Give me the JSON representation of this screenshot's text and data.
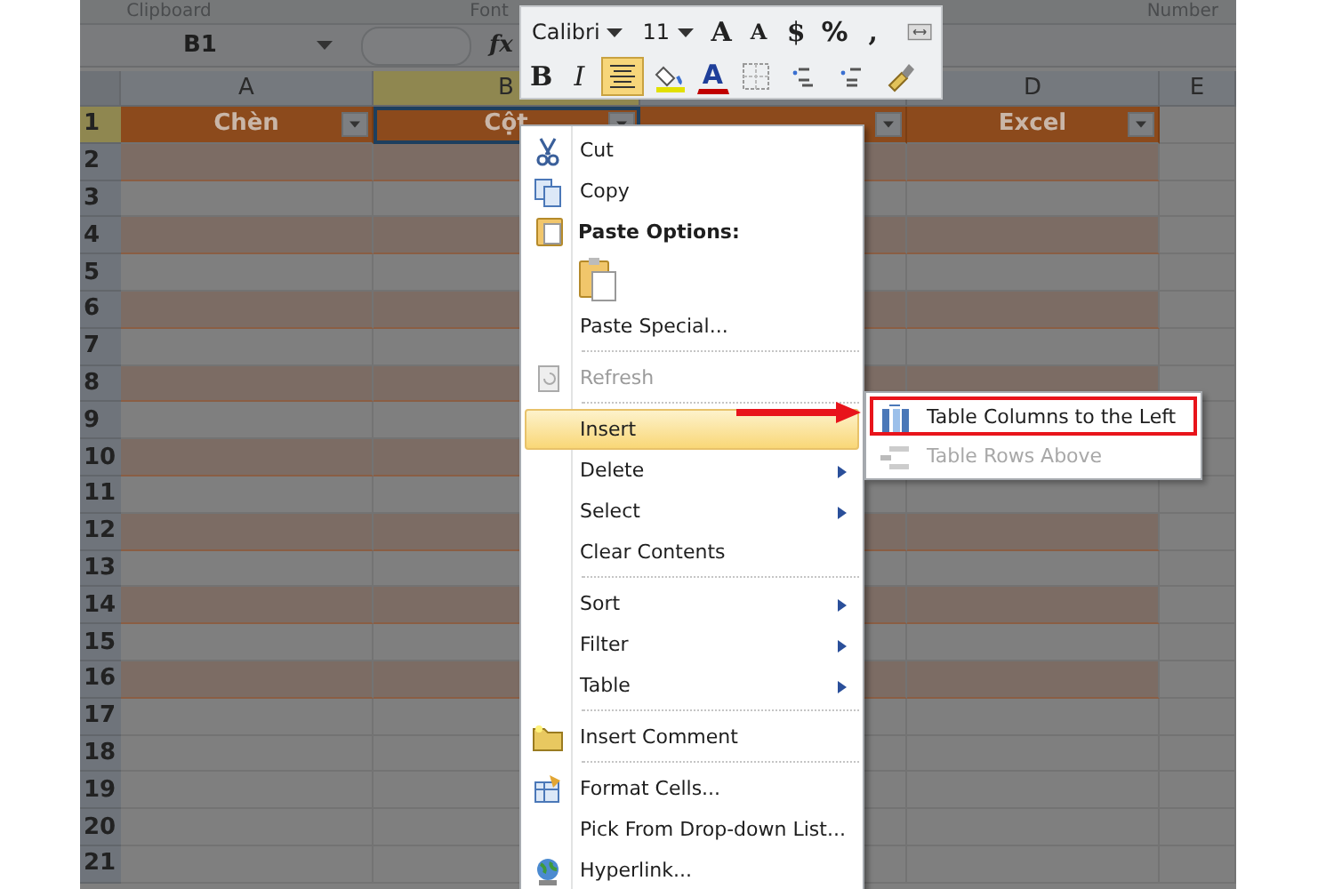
{
  "ribbon_groups": [
    "Clipboard",
    "Font",
    "Number"
  ],
  "name_box": {
    "value": "B1"
  },
  "formula_button": "fx",
  "mini_toolbar": {
    "font": "Calibri",
    "size": "11",
    "top_buttons": [
      {
        "kind": "grow",
        "label": "A"
      },
      {
        "kind": "shrink",
        "label": "A"
      },
      {
        "kind": "currency",
        "label": "$"
      },
      {
        "kind": "percent",
        "label": "%"
      },
      {
        "kind": "comma",
        "label": ","
      },
      {
        "kind": "merge"
      }
    ],
    "bottom_buttons": [
      {
        "kind": "bold",
        "label": "B",
        "selected": false
      },
      {
        "kind": "italic",
        "label": "I",
        "selected": false
      },
      {
        "kind": "center",
        "selected": true
      },
      {
        "kind": "fill",
        "selected": false
      },
      {
        "kind": "fontcolor",
        "label": "A",
        "selected": false
      },
      {
        "kind": "border",
        "selected": false
      },
      {
        "kind": "incdec",
        "selected": false
      },
      {
        "kind": "decdec",
        "selected": false
      },
      {
        "kind": "painter",
        "selected": false
      }
    ]
  },
  "columns": [
    {
      "label": "A",
      "selected": false
    },
    {
      "label": "B",
      "selected": true
    },
    {
      "selected": false
    },
    {
      "label": "D",
      "selected": false
    },
    {
      "label": "E",
      "selected": false
    }
  ],
  "header_cells": [
    {
      "text": "Chèn",
      "selected": false
    },
    {
      "text": "Cột",
      "selected": true
    },
    {
      "selected": false
    },
    {
      "text": "Excel",
      "selected": false
    }
  ],
  "rows": [
    {
      "number": "1",
      "kind": "header"
    },
    {
      "number": "2",
      "kind": "band"
    },
    {
      "number": "3",
      "kind": "plain"
    },
    {
      "number": "4",
      "kind": "band"
    },
    {
      "number": "5",
      "kind": "plain"
    },
    {
      "number": "6",
      "kind": "band"
    },
    {
      "number": "7",
      "kind": "plain"
    },
    {
      "number": "8",
      "kind": "band"
    },
    {
      "number": "9",
      "kind": "plain"
    },
    {
      "number": "10",
      "kind": "band"
    },
    {
      "number": "11",
      "kind": "plain"
    },
    {
      "number": "12",
      "kind": "band"
    },
    {
      "number": "13",
      "kind": "plain"
    },
    {
      "number": "14",
      "kind": "band"
    },
    {
      "number": "15",
      "kind": "plain"
    },
    {
      "number": "16",
      "kind": "band"
    },
    {
      "number": "17",
      "kind": "empty"
    },
    {
      "number": "18",
      "kind": "empty"
    },
    {
      "number": "19",
      "kind": "empty"
    },
    {
      "number": "20",
      "kind": "empty"
    },
    {
      "number": "21",
      "kind": "empty"
    }
  ],
  "context_menu": [
    {
      "kind": "item",
      "label": "Cut",
      "selected": false,
      "disabled": false,
      "submenu": false
    },
    {
      "kind": "item",
      "label": "Copy",
      "selected": false,
      "disabled": false,
      "submenu": false
    },
    {
      "kind": "header",
      "label": "Paste Options:"
    },
    {
      "kind": "icons"
    },
    {
      "kind": "item",
      "label": "Paste Special...",
      "selected": false,
      "disabled": false,
      "submenu": false
    },
    {
      "kind": "item",
      "label": "Refresh",
      "selected": false,
      "disabled": true,
      "submenu": false,
      "separator_before": true
    },
    {
      "kind": "item",
      "label": "Insert",
      "selected": true,
      "disabled": false,
      "submenu": false,
      "separator_before": true
    },
    {
      "kind": "item",
      "label": "Delete",
      "selected": false,
      "disabled": false,
      "submenu": true
    },
    {
      "kind": "item",
      "label": "Select",
      "selected": false,
      "disabled": false,
      "submenu": true
    },
    {
      "kind": "item",
      "label": "Clear Contents",
      "selected": false,
      "disabled": false,
      "submenu": false
    },
    {
      "kind": "item",
      "label": "Sort",
      "selected": false,
      "disabled": false,
      "submenu": true,
      "separator_before": true
    },
    {
      "kind": "item",
      "label": "Filter",
      "selected": false,
      "disabled": false,
      "submenu": true
    },
    {
      "kind": "item",
      "label": "Table",
      "selected": false,
      "disabled": false,
      "submenu": true
    },
    {
      "kind": "item",
      "label": "Insert Comment",
      "selected": false,
      "disabled": false,
      "submenu": false,
      "separator_before": true
    },
    {
      "kind": "item",
      "label": "Format Cells...",
      "selected": false,
      "disabled": false,
      "submenu": false,
      "separator_before": true
    },
    {
      "kind": "item",
      "label": "Pick From Drop-down List...",
      "selected": false,
      "disabled": false,
      "submenu": false
    },
    {
      "kind": "item",
      "label": "Hyperlink...",
      "selected": false,
      "disabled": false,
      "submenu": false
    }
  ],
  "submenu": [
    {
      "label": "Table Columns to the Left",
      "selected": true,
      "disabled": false
    },
    {
      "label": "Table Rows Above",
      "selected": false,
      "disabled": true
    }
  ]
}
